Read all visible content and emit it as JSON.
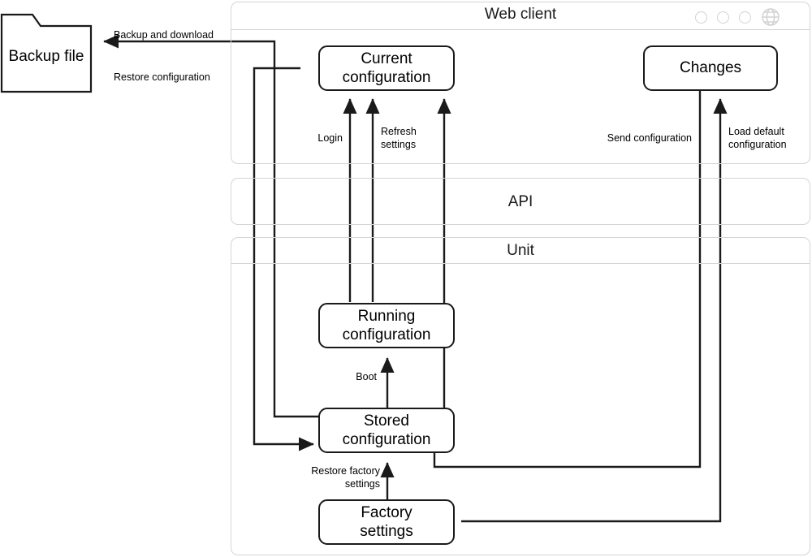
{
  "panels": [
    {
      "name": "web-client",
      "title": "Web client"
    },
    {
      "name": "api",
      "title": "API"
    },
    {
      "name": "unit",
      "title": "Unit"
    }
  ],
  "titlebar_icons": [
    "circle-icon",
    "circle-icon",
    "circle-icon",
    "globe-icon"
  ],
  "nodes": {
    "backup_file": "Backup file",
    "current_configuration": "Current\nconfiguration",
    "changes": "Changes",
    "running_configuration": "Running\nconfiguration",
    "stored_configuration": "Stored\nconfiguration",
    "factory_settings": "Factory\nsettings"
  },
  "edge_labels": {
    "backup_and_download": "Backup and download",
    "restore_configuration": "Restore configuration",
    "login": "Login",
    "refresh_settings": "Refresh\nsettings",
    "send_configuration": "Send configuration",
    "load_default_configuration": "Load default\nconfiguration",
    "boot": "Boot",
    "restore_factory_settings": "Restore factory\nsettings"
  },
  "colors": {
    "stroke": "#1a1a1a",
    "panel_border": "#d5d5d5",
    "background": "#ffffff"
  }
}
